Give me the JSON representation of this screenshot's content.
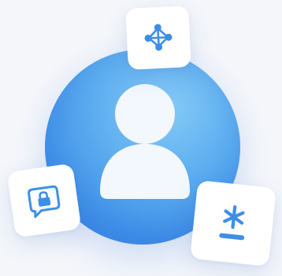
{
  "illustration": {
    "center": {
      "icon": "user-avatar-icon"
    },
    "cards": [
      {
        "icon": "network-nodes-icon"
      },
      {
        "icon": "lock-chat-bubble-icon"
      },
      {
        "icon": "password-asterisk-icon"
      }
    ]
  },
  "colors": {
    "background": "#f4f6fa",
    "orb_light": "#86cbf6",
    "orb_dark": "#3c86e3",
    "icon_blue": "#3d8fe6",
    "card": "#ffffff"
  }
}
